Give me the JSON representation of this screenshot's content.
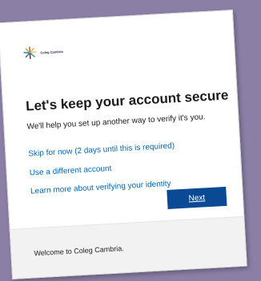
{
  "brand": {
    "name": "Coleg Cambria",
    "logo_icon": "starburst-logo-icon"
  },
  "dialog": {
    "title": "Let's keep your account secure",
    "subtitle": "We'll help you set up another way to verify it's you.",
    "links": {
      "skip": "Skip for now (2 days until this is required)",
      "different_account": "Use a different account",
      "learn_more": "Learn more about verifying your identity"
    },
    "next_label": "Next"
  },
  "footer": {
    "welcome": "Welcome to Coleg Cambria."
  },
  "colors": {
    "background": "#8b7fa6",
    "link": "#0067b8",
    "primary_button": "#0a4a94",
    "footer_bg": "#f2f2f2"
  }
}
